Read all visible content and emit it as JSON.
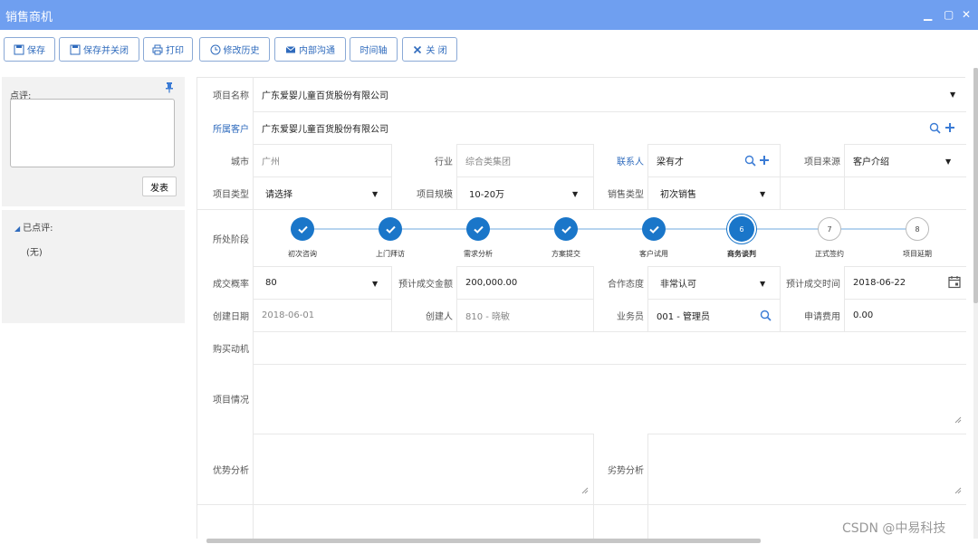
{
  "window": {
    "title": "销售商机",
    "minimize": "▁",
    "maximize": "▢",
    "close": "✕"
  },
  "toolbar": {
    "save": "保存",
    "save_close": "保存并关闭",
    "print": "打印",
    "history": "修改历史",
    "mail": "内部沟通",
    "timeline": "时间轴",
    "close": "关 闭"
  },
  "review": {
    "label": "点评:",
    "post": "发表",
    "reviewed_label": "已点评:",
    "reviewed_empty": "(无)"
  },
  "form": {
    "project_name": {
      "label": "项目名称",
      "value": "广东爱婴儿童百货股份有限公司"
    },
    "customer": {
      "label": "所属客户",
      "value": "广东爱婴儿童百货股份有限公司"
    },
    "city": {
      "label": "城市",
      "value": "广州"
    },
    "industry": {
      "label": "行业",
      "value": "综合类集团"
    },
    "contact": {
      "label": "联系人",
      "value": "梁有才"
    },
    "source": {
      "label": "项目来源",
      "value": "客户介绍"
    },
    "project_type": {
      "label": "项目类型",
      "value": "请选择"
    },
    "scale": {
      "label": "项目规模",
      "value": "10-20万"
    },
    "sales_type": {
      "label": "销售类型",
      "value": "初次销售"
    },
    "stage_label": "所处阶段",
    "stages": [
      {
        "label": "初次咨询",
        "status": "done"
      },
      {
        "label": "上门拜访",
        "status": "done"
      },
      {
        "label": "需求分析",
        "status": "done"
      },
      {
        "label": "方案提交",
        "status": "done"
      },
      {
        "label": "客户试用",
        "status": "done"
      },
      {
        "label": "商务谈判",
        "status": "current",
        "num": "6"
      },
      {
        "label": "正式签约",
        "status": "future",
        "num": "7"
      },
      {
        "label": "项目延期",
        "status": "future",
        "num": "8"
      }
    ],
    "probability": {
      "label": "成交概率",
      "value": "80"
    },
    "amount": {
      "label": "预计成交金额",
      "value": "200,000.00"
    },
    "attitude": {
      "label": "合作态度",
      "value": "非常认可"
    },
    "deal_time": {
      "label": "预计成交时间",
      "value": "2018-06-22"
    },
    "created_date": {
      "label": "创建日期",
      "value": "2018-06-01"
    },
    "creator": {
      "label": "创建人",
      "value": "810 - 晓敏"
    },
    "salesman": {
      "label": "业务员",
      "value": "001 - 管理员"
    },
    "expense": {
      "label": "申请费用",
      "value": "0.00"
    },
    "motive": {
      "label": "购买动机"
    },
    "situation": {
      "label": "项目情况"
    },
    "advantage": {
      "label": "优势分析"
    },
    "disadvantage": {
      "label": "劣势分析"
    }
  },
  "watermark": "CSDN @中易科技",
  "colors": {
    "titlebar": "#6f9ff0",
    "accent": "#1a76c9",
    "link": "#2f6bbd"
  }
}
